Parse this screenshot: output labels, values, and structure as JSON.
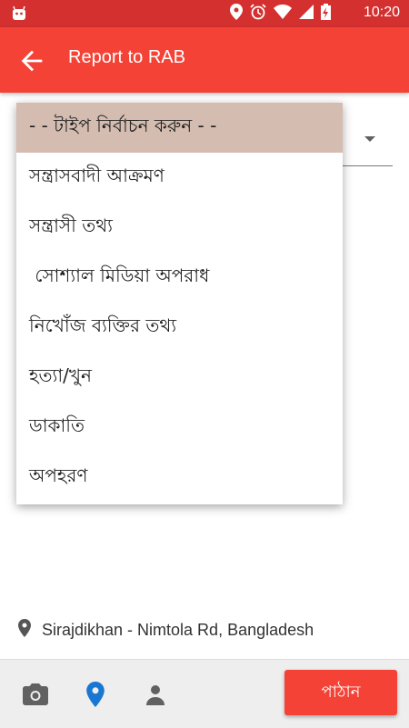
{
  "status_bar": {
    "time": "10:20",
    "icons": [
      "android-icon",
      "location-icon",
      "alarm-icon",
      "wifi-icon",
      "signal-icon",
      "battery-charging-icon"
    ]
  },
  "app_bar": {
    "title": "Report to RAB"
  },
  "type_select": {
    "options": [
      "- - টাইপ নির্বাচন করুন - -",
      "সন্ত্রাসবাদী আক্রমণ",
      "সন্ত্রাসী তথ্য",
      " সোশ্যাল মিডিয়া অপরাধ",
      "নিখোঁজ ব্যক্তির তথ্য",
      "হত্যা/খুন",
      "ডাকাতি",
      "অপহরণ"
    ],
    "selected_index": 0
  },
  "location": {
    "text": "Sirajdikhan - Nimtola Rd, Bangladesh"
  },
  "bottom_bar": {
    "icons": [
      "camera-icon",
      "location-pin-icon",
      "person-icon"
    ],
    "active_color": "#1976d2",
    "send_label": "পাঠান"
  },
  "colors": {
    "status_bar": "#d3302f",
    "app_bar": "#f44336",
    "selected_option": "#d5bcb0",
    "send_button": "#f44336"
  }
}
